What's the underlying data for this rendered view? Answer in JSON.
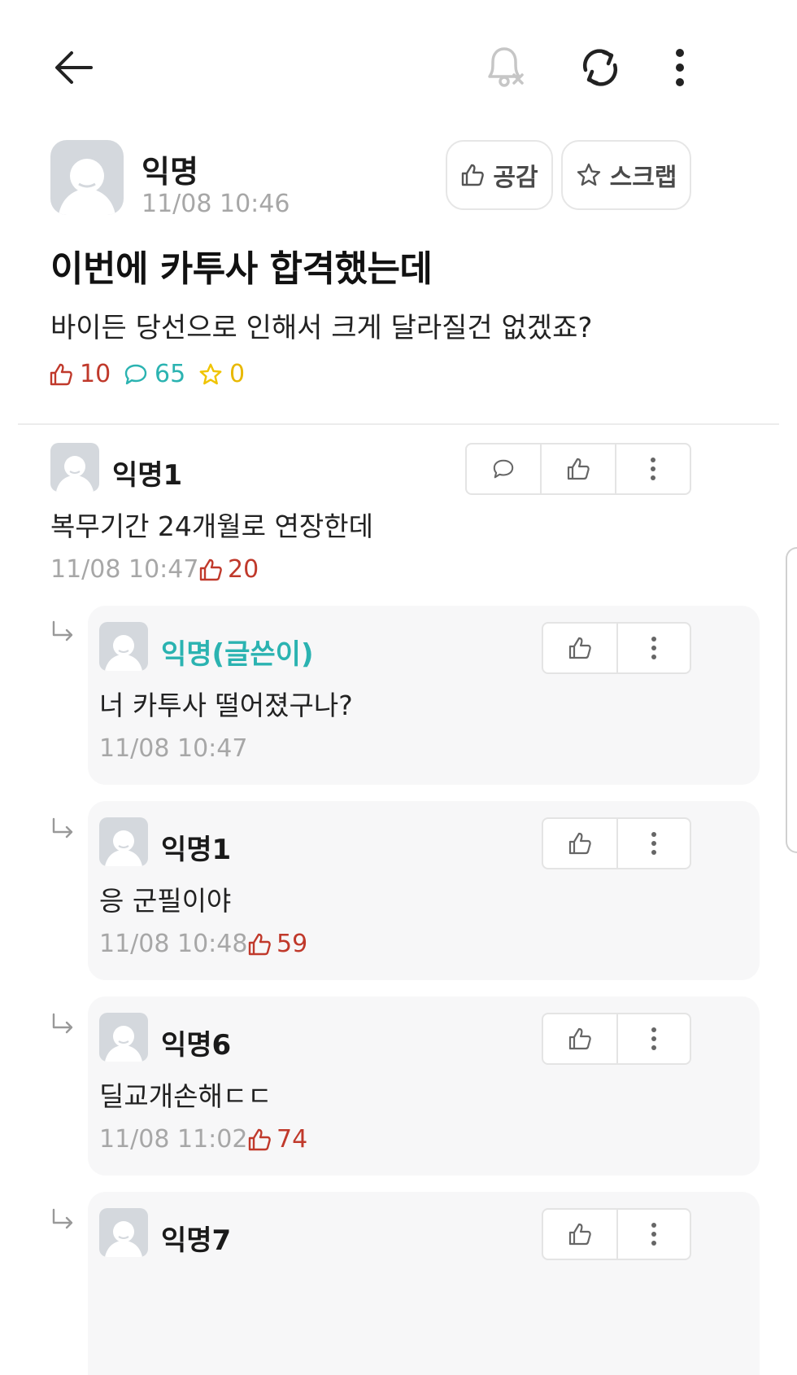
{
  "topbar": {
    "back_icon": "back-arrow-icon",
    "notify_icon": "bell-off-icon",
    "refresh_icon": "refresh-icon",
    "more_icon": "more-vertical-icon"
  },
  "post": {
    "author": "익명",
    "time": "11/08 10:46",
    "like_button": "공감",
    "scrap_button": "스크랩",
    "title": "이번에 카투사 합격했는데",
    "body": "바이든 당선으로 인해서 크게 달라질건 없겠죠?",
    "stats": {
      "likes": "10",
      "comments": "65",
      "scraps": "0"
    }
  },
  "colors": {
    "like": "#c0392b",
    "comment": "#2bb3b1",
    "scrap": "#f0c400",
    "writer": "#2bb3b1"
  },
  "comments": [
    {
      "author": "익명1",
      "text": "복무기간 24개월로 연장한데",
      "time": "11/08 10:47",
      "likes": "20"
    }
  ],
  "replies": [
    {
      "author": "익명(글쓴이)",
      "text": "너 카투사 떨어졌구나?",
      "time": "11/08 10:47",
      "likes": ""
    },
    {
      "author": "익명1",
      "text": "응 군필이야",
      "time": "11/08 10:48",
      "likes": "59"
    },
    {
      "author": "익명6",
      "text": "딜교개손해ㄷㄷ",
      "time": "11/08 11:02",
      "likes": "74"
    },
    {
      "author": "익명7",
      "text": "",
      "time": "",
      "likes": ""
    }
  ]
}
